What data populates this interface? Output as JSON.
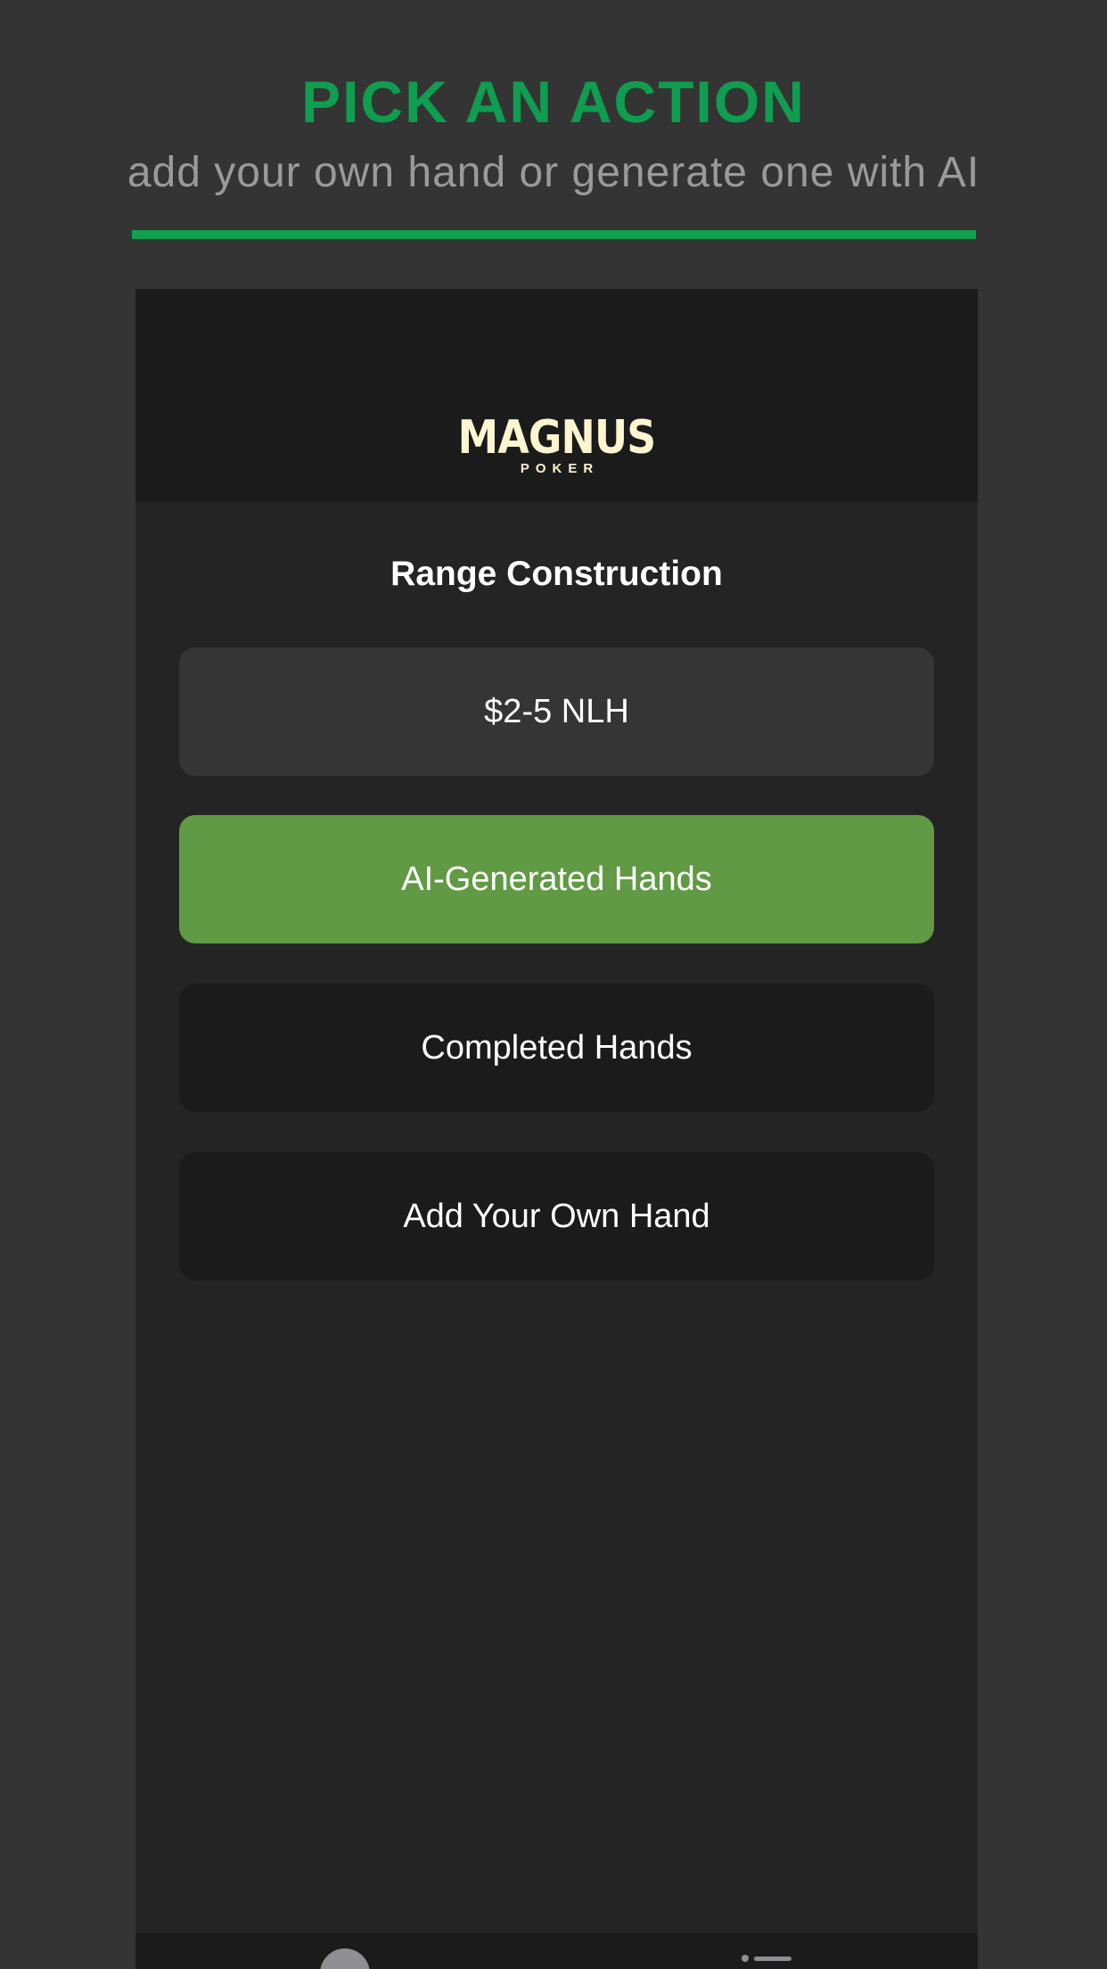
{
  "promo": {
    "headline": "PICK AN ACTION",
    "subheadline": "add your own hand or generate one with AI",
    "accent_color": "#0f9d4f"
  },
  "app": {
    "logo": {
      "name": "MAGNUS",
      "sub": "POKER",
      "color": "#fdf5cf"
    },
    "screen_title": "Range Construction",
    "menu": [
      {
        "label": "$2-5 NLH",
        "color": "#353535"
      },
      {
        "label": "AI-Generated Hands",
        "color": "#619a44"
      },
      {
        "label": "Completed Hands",
        "color": "#1b1b1b"
      },
      {
        "label": "Add Your Own Hand",
        "color": "#1b1b1b"
      }
    ],
    "bottom_nav": {
      "icons": [
        "profile-icon",
        "menu-icon"
      ]
    }
  }
}
